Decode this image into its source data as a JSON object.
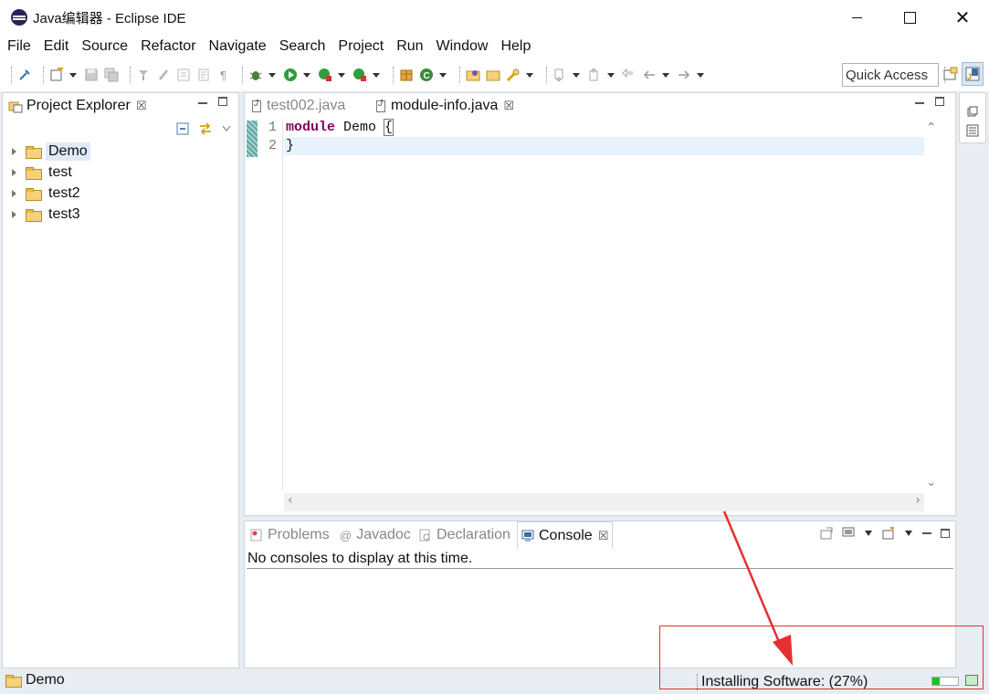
{
  "window": {
    "title": "Java编辑器 - Eclipse IDE"
  },
  "menubar": {
    "items": [
      "File",
      "Edit",
      "Source",
      "Refactor",
      "Navigate",
      "Search",
      "Project",
      "Run",
      "Window",
      "Help"
    ]
  },
  "toolbar": {
    "quick_access_placeholder": "Quick Access"
  },
  "project_explorer": {
    "tab_label": "Project Explorer",
    "items": [
      {
        "label": "Demo",
        "selected": true
      },
      {
        "label": "test",
        "selected": false
      },
      {
        "label": "test2",
        "selected": false
      },
      {
        "label": "test3",
        "selected": false
      }
    ]
  },
  "editor": {
    "tabs": [
      {
        "label": "test002.java",
        "active": false
      },
      {
        "label": "module-info.java",
        "active": true
      }
    ],
    "line_numbers": [
      "1",
      "2"
    ],
    "code": {
      "keyword": "module",
      "name": " Demo ",
      "open_brace": "{",
      "close_brace": "}"
    }
  },
  "console_view": {
    "tabs": [
      {
        "label": "Problems",
        "active": false
      },
      {
        "label": "Javadoc",
        "active": false
      },
      {
        "label": "Declaration",
        "active": false
      },
      {
        "label": "Console",
        "active": true
      }
    ],
    "message": "No consoles to display at this time."
  },
  "statusbar": {
    "selected_item": "Demo",
    "progress_text": "Installing Software: (27%)",
    "progress_percent": 27
  },
  "colors": {
    "annotation_red": "#e53030",
    "progress_green": "#1ec31e",
    "keyword": "#7f0055"
  }
}
